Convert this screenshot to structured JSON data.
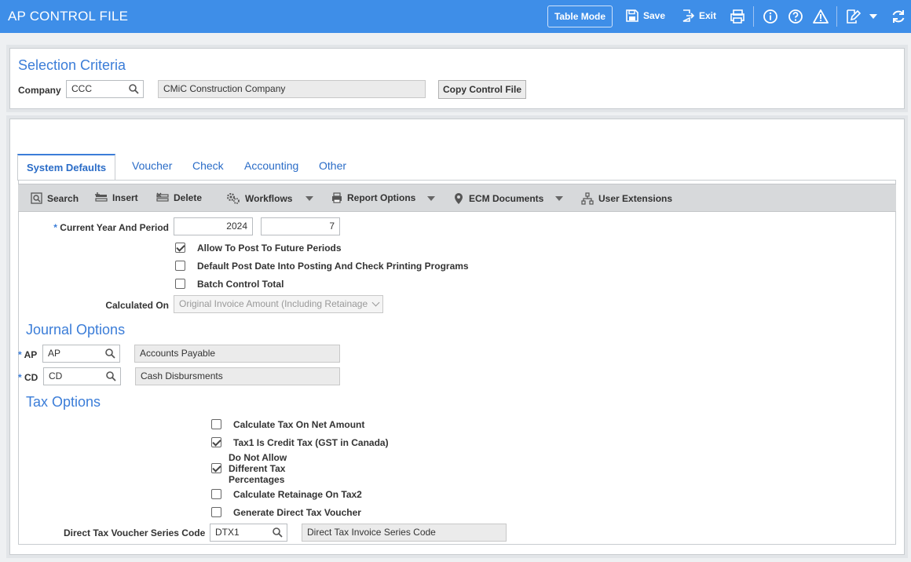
{
  "app": {
    "title": "AP CONTROL FILE",
    "table_mode_label": "Table Mode",
    "save_label": "Save",
    "exit_label": "Exit"
  },
  "selection": {
    "title": "Selection Criteria",
    "company_label": "Company",
    "company_value": "CCC",
    "company_name": "CMiC Construction Company",
    "copy_button": "Copy Control File"
  },
  "tabs": [
    "System Defaults",
    "Voucher",
    "Check",
    "Accounting",
    "Other"
  ],
  "toolbar": {
    "search": "Search",
    "insert": "Insert",
    "delete": "Delete",
    "workflows": "Workflows",
    "report_options": "Report Options",
    "ecm_documents": "ECM Documents",
    "user_extensions": "User Extensions"
  },
  "system_defaults": {
    "year_period_label": "Current Year And Period",
    "year": "2024",
    "period": "7",
    "allow_future_label": "Allow To Post To Future Periods",
    "allow_future_checked": true,
    "default_post_date_label": "Default Post Date Into Posting And Check Printing Programs",
    "default_post_date_checked": false,
    "batch_control_label": "Batch Control Total",
    "batch_control_checked": false,
    "calculated_on_label": "Calculated On",
    "calculated_on_value": "Original Invoice Amount (Including Retainage"
  },
  "journal": {
    "title": "Journal Options",
    "ap_label": "AP",
    "ap_value": "AP",
    "ap_desc": "Accounts Payable",
    "cd_label": "CD",
    "cd_value": "CD",
    "cd_desc": "Cash Disbursments"
  },
  "tax": {
    "title": "Tax Options",
    "calc_net_label": "Calculate Tax On Net Amount",
    "calc_net_checked": false,
    "tax1_credit_label": "Tax1 Is Credit Tax (GST in Canada)",
    "tax1_credit_checked": true,
    "no_diff_label_1": "Do Not Allow",
    "no_diff_label_2": "Different Tax",
    "no_diff_label_3": "Percentages",
    "no_diff_checked": true,
    "retainage_tax2_label": "Calculate Retainage On Tax2",
    "retainage_tax2_checked": false,
    "gen_direct_label": "Generate Direct Tax Voucher",
    "gen_direct_checked": false,
    "series_label": "Direct Tax Voucher Series Code",
    "series_value": "DTX1",
    "series_desc": "Direct Tax Invoice Series Code"
  }
}
